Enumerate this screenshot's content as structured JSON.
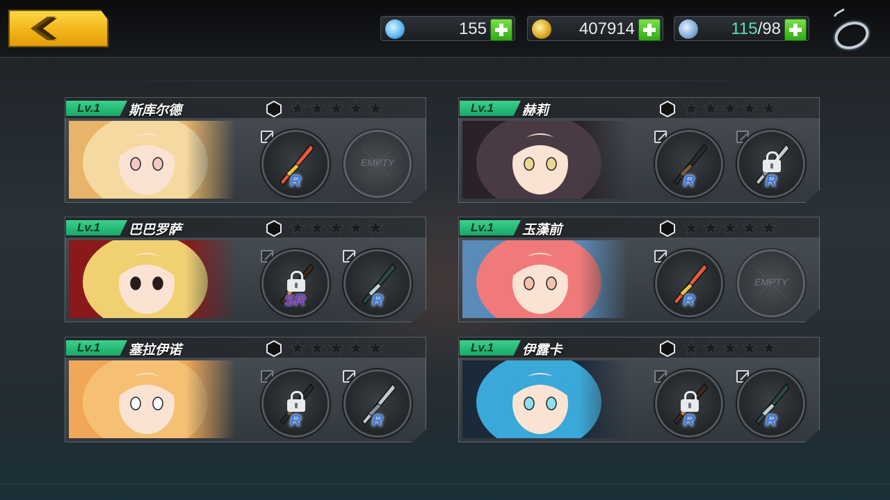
{
  "topbar": {
    "gems": "155",
    "gold": "407914",
    "stamina_current": "115",
    "stamina_max": "/98"
  },
  "colors": {
    "accent_yellow": "#f2b51a",
    "level_green": "#1aa868",
    "rarity_r": "#3a78e8",
    "rarity_sr": "#7a3cc8"
  },
  "cards": [
    {
      "level": "Lv.1",
      "name": "斯库尔德",
      "portrait_theme": [
        "#f5d9a0",
        "#e8b46a",
        "#f4c8c8"
      ],
      "slots": [
        {
          "state": "weapon",
          "rarity": "R",
          "locked": false,
          "icon": "sword-icon"
        },
        {
          "state": "empty",
          "label": "EMPTY"
        }
      ]
    },
    {
      "level": "Lv.1",
      "name": "赫莉",
      "portrait_theme": [
        "#4a3a44",
        "#2a2228",
        "#e8d890"
      ],
      "slots": [
        {
          "state": "weapon",
          "rarity": "R",
          "locked": false,
          "icon": "gun-icon"
        },
        {
          "state": "weapon",
          "rarity": "R",
          "locked": true,
          "icon": "gun-icon"
        }
      ]
    },
    {
      "level": "Lv.1",
      "name": "巴巴罗萨",
      "portrait_theme": [
        "#f0d070",
        "#8a1a1a",
        "#2a1a18"
      ],
      "slots": [
        {
          "state": "weapon",
          "rarity": "SR",
          "locked": true,
          "icon": "rifle-icon"
        },
        {
          "state": "weapon",
          "rarity": "R",
          "locked": false,
          "icon": "blade-icon"
        }
      ]
    },
    {
      "level": "Lv.1",
      "name": "玉藻前",
      "portrait_theme": [
        "#f07a7a",
        "#5a8ab8",
        "#f4c0b0"
      ],
      "slots": [
        {
          "state": "weapon",
          "rarity": "R",
          "locked": false,
          "icon": "orb-icon"
        },
        {
          "state": "empty",
          "label": "EMPTY"
        }
      ]
    },
    {
      "level": "Lv.1",
      "name": "塞拉伊诺",
      "portrait_theme": [
        "#f6c074",
        "#f0a858",
        "#ffffff"
      ],
      "slots": [
        {
          "state": "weapon",
          "rarity": "R",
          "locked": true,
          "icon": "staff-icon"
        },
        {
          "state": "weapon",
          "rarity": "R",
          "locked": false,
          "icon": "lance-icon"
        }
      ]
    },
    {
      "level": "Lv.1",
      "name": "伊露卡",
      "portrait_theme": [
        "#3aa8d8",
        "#1a2a3a",
        "#8ae0f0"
      ],
      "slots": [
        {
          "state": "weapon",
          "rarity": "R",
          "locked": true,
          "icon": "spear-icon"
        },
        {
          "state": "weapon",
          "rarity": "R",
          "locked": false,
          "icon": "twin-blade-icon"
        }
      ]
    }
  ]
}
